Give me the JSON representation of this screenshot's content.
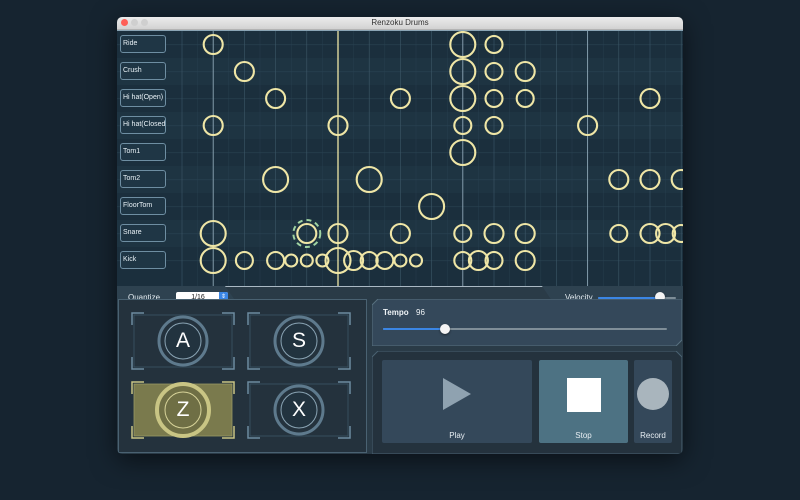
{
  "window": {
    "title": "Renzoku Drums"
  },
  "sequencer": {
    "tracks": [
      {
        "label": "Ride",
        "notes": [
          {
            "step": 2,
            "size": "m"
          },
          {
            "step": 10,
            "size": "l"
          },
          {
            "step": 11,
            "size": "s"
          }
        ]
      },
      {
        "label": "Crush",
        "notes": [
          {
            "step": 3,
            "size": "m"
          },
          {
            "step": 10,
            "size": "l"
          },
          {
            "step": 11,
            "size": "s"
          },
          {
            "step": 12,
            "size": "m"
          }
        ]
      },
      {
        "label": "Hi hat(Open)",
        "notes": [
          {
            "step": 4,
            "size": "m"
          },
          {
            "step": 8,
            "size": "m"
          },
          {
            "step": 10,
            "size": "l"
          },
          {
            "step": 11,
            "size": "s"
          },
          {
            "step": 12,
            "size": "s"
          },
          {
            "step": 16,
            "size": "m"
          }
        ]
      },
      {
        "label": "Hi hat(Closed)",
        "notes": [
          {
            "step": 2,
            "size": "m"
          },
          {
            "step": 6,
            "size": "m"
          },
          {
            "step": 10,
            "size": "s"
          },
          {
            "step": 11,
            "size": "s"
          },
          {
            "step": 14,
            "size": "m"
          }
        ]
      },
      {
        "label": "Tom1",
        "notes": [
          {
            "step": 10,
            "size": "l"
          }
        ]
      },
      {
        "label": "Tom2",
        "notes": [
          {
            "step": 4,
            "size": "l"
          },
          {
            "step": 7,
            "size": "l"
          },
          {
            "step": 15,
            "size": "m"
          },
          {
            "step": 16,
            "size": "m"
          },
          {
            "step": 17,
            "size": "m"
          }
        ]
      },
      {
        "label": "FloorTom",
        "notes": [
          {
            "step": 9,
            "size": "l"
          }
        ]
      },
      {
        "label": "Snare",
        "notes": [
          {
            "step": 2,
            "size": "l"
          },
          {
            "step": 5,
            "size": "m"
          },
          {
            "step": 6,
            "size": "m"
          },
          {
            "step": 8,
            "size": "m"
          },
          {
            "step": 10,
            "size": "s"
          },
          {
            "step": 11,
            "size": "m"
          },
          {
            "step": 12,
            "size": "m"
          },
          {
            "step": 15,
            "size": "s"
          },
          {
            "step": 16,
            "size": "m"
          },
          {
            "step": 16.5,
            "size": "m"
          },
          {
            "step": 17,
            "size": "s"
          }
        ]
      },
      {
        "label": "Kick",
        "notes": [
          {
            "step": 2,
            "size": "l"
          },
          {
            "step": 3,
            "size": "s"
          },
          {
            "step": 4,
            "size": "s"
          },
          {
            "step": 4.5,
            "size": "xs"
          },
          {
            "step": 5,
            "size": "xs"
          },
          {
            "step": 5.5,
            "size": "xs"
          },
          {
            "step": 6,
            "size": "l"
          },
          {
            "step": 6.5,
            "size": "m"
          },
          {
            "step": 7,
            "size": "s"
          },
          {
            "step": 7.5,
            "size": "s"
          },
          {
            "step": 8,
            "size": "xs"
          },
          {
            "step": 8.5,
            "size": "xs"
          },
          {
            "step": 10,
            "size": "s"
          },
          {
            "step": 10.5,
            "size": "m"
          },
          {
            "step": 11,
            "size": "s"
          },
          {
            "step": 12,
            "size": "m"
          }
        ]
      }
    ],
    "steps": 17,
    "playhead_step": 6,
    "pressed_note": {
      "track": 7,
      "step": 5
    }
  },
  "controls": {
    "quantize_label": "Quantize",
    "quantize_value": "1/16",
    "quantize_stepper_glyph": "⇕",
    "velocity_label": "Velocity",
    "velocity_fraction": 0.8
  },
  "pads": [
    {
      "letter": "A",
      "active": false
    },
    {
      "letter": "S",
      "active": false
    },
    {
      "letter": "Z",
      "active": true
    },
    {
      "letter": "X",
      "active": false
    }
  ],
  "tempo": {
    "label": "Tempo",
    "value": "96",
    "fraction": 0.22
  },
  "transport": {
    "play_label": "Play",
    "stop_label": "Stop",
    "record_label": "Record"
  },
  "colors": {
    "note": "#efe6a6",
    "pad_active": "#c9c584",
    "pad_idle": "#6d8ba0",
    "accent": "#3b86e4"
  },
  "icons": {
    "play": "play-icon",
    "stop": "stop-icon",
    "record": "record-icon",
    "quantize_stepper": "up-down-arrows-icon"
  }
}
